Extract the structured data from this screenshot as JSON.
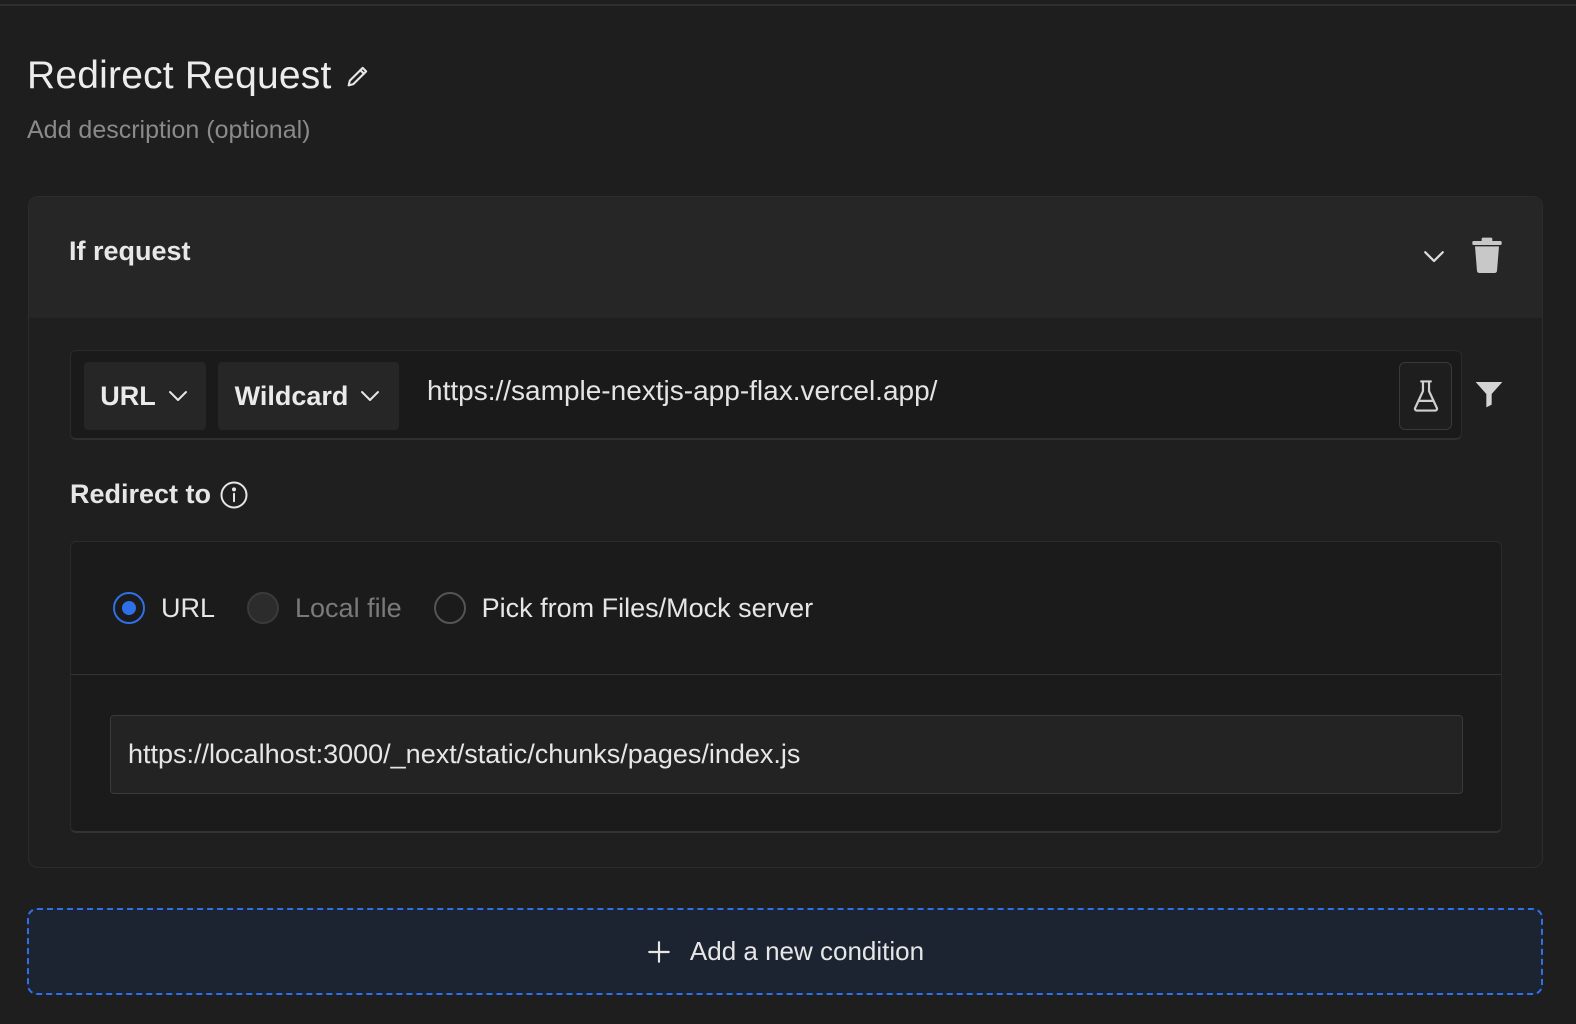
{
  "header": {
    "title": "Redirect Request",
    "description_placeholder": "Add description (optional)"
  },
  "condition_card": {
    "heading": "If request",
    "source_field": "URL",
    "operator": "Wildcard",
    "match_value": "https://sample-nextjs-app-flax.vercel.app/"
  },
  "redirect": {
    "label": "Redirect to",
    "options": [
      {
        "label": "URL",
        "state": "checked"
      },
      {
        "label": "Local file",
        "state": "disabled"
      },
      {
        "label": "Pick from Files/Mock server",
        "state": "unchecked"
      }
    ],
    "destination": "https://localhost:3000/_next/static/chunks/pages/index.js"
  },
  "add_condition_label": "Add a new condition",
  "colors": {
    "accent": "#2f6fe8",
    "background": "#1e1e1e",
    "card_header": "#262626"
  }
}
